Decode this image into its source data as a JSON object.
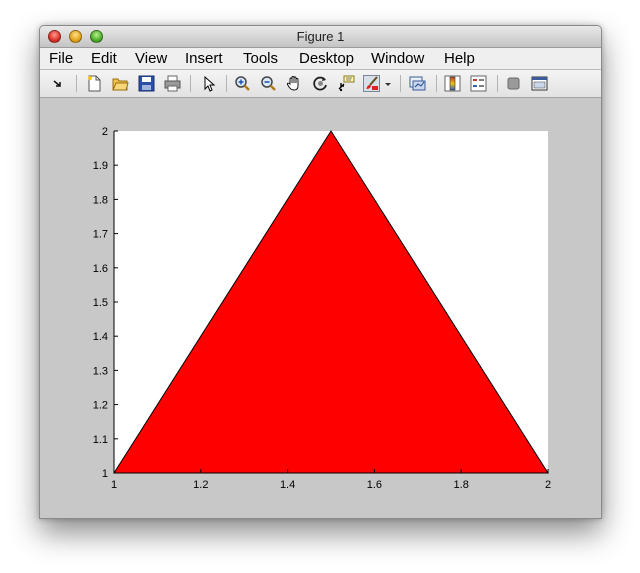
{
  "window": {
    "title": "Figure 1"
  },
  "menu": [
    "File",
    "Edit",
    "View",
    "Insert",
    "Tools",
    "Desktop",
    "Window",
    "Help"
  ],
  "toolbar": {
    "icons": [
      "dock-arrow-icon",
      "new-figure-icon",
      "open-file-icon",
      "save-icon",
      "print-icon",
      "edit-plot-arrow-icon",
      "zoom-in-icon",
      "zoom-out-icon",
      "pan-hand-icon",
      "rotate-3d-icon",
      "data-cursor-icon",
      "brush-icon",
      "brush-dropdown-icon",
      "link-plot-icon",
      "insert-colorbar-icon",
      "insert-legend-icon",
      "hide-plot-tools-icon",
      "show-plot-tools-icon"
    ]
  },
  "colors": {
    "fill": "#ff0000",
    "axes_bg": "#ffffff",
    "figure_bg": "#c8c8c8"
  },
  "chart_data": {
    "type": "area",
    "shape": "filled polygon",
    "x": [
      1,
      1.5,
      2
    ],
    "y": [
      1,
      2,
      1
    ],
    "fill_color": "#ff0000",
    "edge_color": "#000000",
    "xlim": [
      1,
      2
    ],
    "ylim": [
      1,
      2
    ],
    "xticks": [
      1,
      1.2,
      1.4,
      1.6,
      1.8,
      2
    ],
    "xtick_labels": [
      "1",
      "1.2",
      "1.4",
      "1.6",
      "1.8",
      "2"
    ],
    "yticks": [
      1,
      1.1,
      1.2,
      1.3,
      1.4,
      1.5,
      1.6,
      1.7,
      1.8,
      1.9,
      2
    ],
    "ytick_labels": [
      "1",
      "1.1",
      "1.2",
      "1.3",
      "1.4",
      "1.5",
      "1.6",
      "1.7",
      "1.8",
      "1.9",
      "2"
    ],
    "title": "",
    "xlabel": "",
    "ylabel": "",
    "grid": false
  }
}
